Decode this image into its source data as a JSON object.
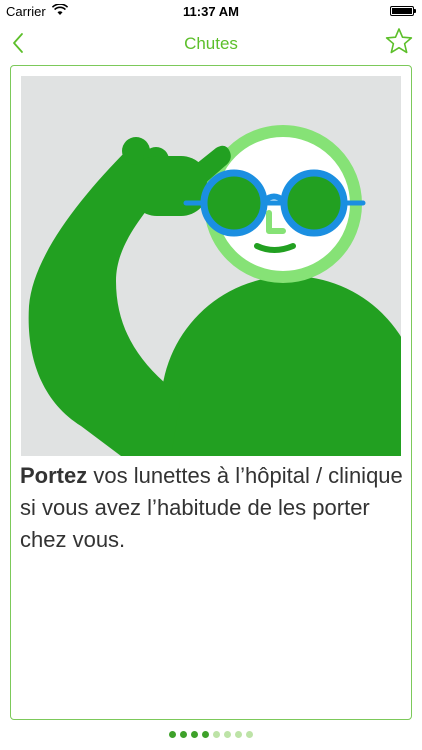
{
  "status_bar": {
    "carrier": "Carrier",
    "time": "11:37 AM"
  },
  "nav": {
    "title": "Chutes",
    "back_icon": "chevron-left-icon",
    "favorite_icon": "star-outline-icon",
    "accent_color": "#5cbf2a"
  },
  "card": {
    "illustration": "person-wearing-glasses-illustration",
    "text_bold": "Portez",
    "text_rest": " vos lunettes à l’hôpital / clinique si vous avez l’habitude de les porter chez vous."
  },
  "pager": {
    "total": 8,
    "active": [
      0,
      1,
      2,
      3
    ]
  },
  "colors": {
    "figure_green": "#22a021",
    "head_ring": "#86e276",
    "glasses_blue": "#1b8fe1",
    "illustration_bg": "#e0e2e2",
    "dot_active": "#3ea12a",
    "dot_inactive": "#bde3a7"
  }
}
